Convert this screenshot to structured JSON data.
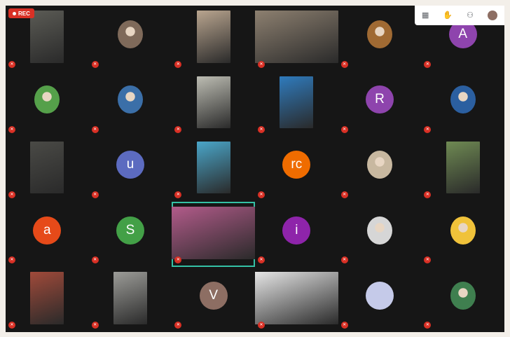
{
  "recording": {
    "label": "REC",
    "color": "#d93025"
  },
  "toolbar": {
    "icons": [
      {
        "name": "grid-layout-icon",
        "glyph": "▦"
      },
      {
        "name": "raise-hand-icon",
        "glyph": "✋"
      },
      {
        "name": "activities-icon",
        "glyph": "⚇"
      },
      {
        "name": "self-avatar-icon",
        "glyph": ""
      }
    ]
  },
  "accent": {
    "active_speaker": "#34c1a5",
    "muted": "#d93025"
  },
  "participants": [
    {
      "name": "",
      "kind": "video",
      "color": "#5b5b55",
      "w": 48
    },
    {
      "name": "",
      "kind": "photo",
      "color": "#7f6a5a"
    },
    {
      "name": "",
      "kind": "video",
      "color": "#b9a58f",
      "w": 48
    },
    {
      "name": "",
      "kind": "video",
      "color": "#8d8070",
      "w": 120
    },
    {
      "name": "",
      "kind": "photo",
      "color": "#a06a33"
    },
    {
      "name": "",
      "kind": "avatar",
      "letter": "A",
      "color": "#8e44ad"
    },
    {
      "name": "",
      "kind": "photo",
      "color": "#55a04a"
    },
    {
      "name": "",
      "kind": "photo",
      "color": "#3b6fa8"
    },
    {
      "name": "",
      "kind": "video",
      "color": "#bdbdb3",
      "w": 48
    },
    {
      "name": "",
      "kind": "video",
      "color": "#2f7bbd",
      "w": 48
    },
    {
      "name": "",
      "kind": "avatar",
      "letter": "R",
      "color": "#8e44ad"
    },
    {
      "name": "",
      "kind": "photo",
      "color": "#2b5fa0"
    },
    {
      "name": "",
      "kind": "video",
      "color": "#4a4a46",
      "w": 48
    },
    {
      "name": "",
      "kind": "avatar",
      "letter": "u",
      "color": "#5c6bc0"
    },
    {
      "name": "",
      "kind": "video",
      "color": "#4aa6c9",
      "w": 48
    },
    {
      "name": "",
      "kind": "avatar",
      "letter": "rc",
      "color": "#ef6c00"
    },
    {
      "name": "",
      "kind": "photo",
      "color": "#c8b8a0"
    },
    {
      "name": "",
      "kind": "video",
      "color": "#6f8a53",
      "w": 48
    },
    {
      "name": "",
      "kind": "avatar",
      "letter": "a",
      "color": "#e64a19"
    },
    {
      "name": "",
      "kind": "avatar",
      "letter": "S",
      "color": "#43a047"
    },
    {
      "name": "",
      "kind": "video",
      "color": "#b25b8a",
      "w": 120,
      "active": true
    },
    {
      "name": "",
      "kind": "avatar",
      "letter": "i",
      "color": "#8e24aa"
    },
    {
      "name": "",
      "kind": "photo",
      "color": "#d6d6d6"
    },
    {
      "name": "",
      "kind": "photo",
      "color": "#f0c23a"
    },
    {
      "name": "",
      "kind": "video",
      "color": "#a04a3a",
      "w": 48
    },
    {
      "name": "",
      "kind": "video",
      "color": "#9c9c98",
      "w": 48
    },
    {
      "name": "",
      "kind": "avatar",
      "letter": "V",
      "color": "#8d6e63"
    },
    {
      "name": "",
      "kind": "video",
      "color": "#e6e6e6",
      "w": 120
    },
    {
      "name": "",
      "kind": "avatar",
      "letter": "",
      "color": "#c5cae9"
    },
    {
      "name": "",
      "kind": "photo",
      "color": "#3f7f4f"
    }
  ]
}
